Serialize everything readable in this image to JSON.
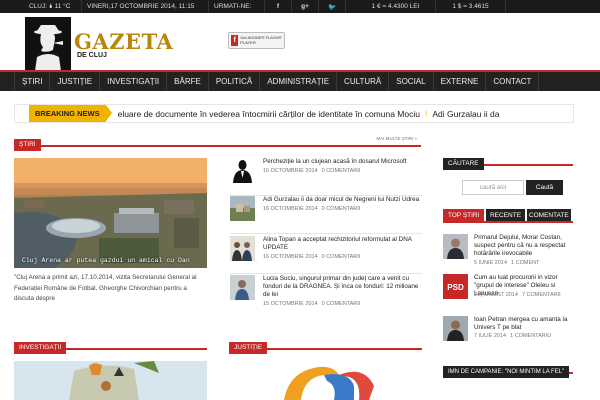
{
  "topbar": {
    "weather": "CLUJ: 🌢 11 °C",
    "date": "VINERI,17 OCTOMBRIE 2014, 11:15",
    "follow": "URMATI-NE:",
    "social": [
      "f",
      "g+",
      "🐦"
    ],
    "euro_rate": "1 € = 4.4300 LEI",
    "usd_rate": "1 $ = 3.4615"
  },
  "logo": {
    "title": "GAZETA",
    "subtitle": "DE CLUJ"
  },
  "flash_badge": {
    "icon": "f",
    "text": "Get ADOBE® FLASH® PLAYER"
  },
  "nav": {
    "items": [
      "ȘTIRI",
      "JUSTIȚIE",
      "INVESTIGAȚII",
      "BÂRFE",
      "POLITICĂ",
      "ADMINISTRAȚIE",
      "CULTURĂ",
      "SOCIAL",
      "EXTERNE",
      "CONTACT"
    ]
  },
  "breaking": {
    "label": "BREAKING NEWS",
    "ticker": [
      "eluare de documente în vederea întocmirii cărților de identitate în comuna Mociu",
      "Adi Gurzalau ii da"
    ]
  },
  "stiri_section": {
    "label": "ȘTIRI",
    "more": "MAI MULTE ȘTIRI »"
  },
  "featured": {
    "caption": "Cluj Arena ar putea gazdui un amical cu Dan",
    "excerpt": "\"Cluj Arena a primit azi, 17.10.2014, vizita Secretarului General al Federației Române de Fotbal, Gheorghe Chivorchian pentru a discuta despre"
  },
  "news_list": [
    {
      "title": "Percheziție la un clujean acasă în dosarul Microsoft",
      "date": "16 OCTOMBRIE 2014",
      "comments": "0 COMENTARII"
    },
    {
      "title": "Adi Gurzalau ii da doar micul de Negreni lui Nutzi Udrea",
      "date": "16 OCTOMBRIE 2014",
      "comments": "0 COMENTARII"
    },
    {
      "title": "Alina Topan a acceptat rechizitoriul reformulat al DNA UPDATE",
      "date": "16 OCTOMBRIE 2014",
      "comments": "0 COMENTARII"
    },
    {
      "title": "Lucia Suciu, singurul primar din județ care a venit cu fonduri de la DRAGNEA. Și înca ce fonduri: 12 milioane de lei",
      "date": "15 OCTOMBRIE 2014",
      "comments": "0 COMENTARII"
    }
  ],
  "investigatii_section": {
    "label": "INVESTIGAȚII"
  },
  "justitie_section": {
    "label": "JUSTIȚIE"
  },
  "sidebar": {
    "search_head": "CĂUTARE",
    "search_placeholder": "caută aici",
    "search_button": "Caută",
    "tabs": [
      "TOP ȘTIRI",
      "RECENTE",
      "COMENTATE"
    ],
    "items": [
      {
        "title": "Primarul Dejului, Morar Costan, suspect pentru că nu a respectat hotărârile irevocabile",
        "date": "",
        "comments": ""
      },
      {
        "title": "Cum au luat procurorii in vizor \"grupul de interese\" Oleleu si Lapusan",
        "date": "21 AUGUST 2014",
        "comments": "7 COMENTARII"
      },
      {
        "title": "Ioan Petran mergea cu amanta la Univers T pe blat",
        "date": "7 IULIE 2014",
        "comments": "1 COMENTARIU"
      }
    ],
    "pre_item_meta": {
      "date": "5 IUNIE 2014",
      "comments": "1 COMENT"
    },
    "campaign_head": "IMN DE CAMPANIE: \"NOI MINTIM LA FEL\""
  },
  "colors": {
    "accent": "#c62828",
    "breaking": "#f0b400",
    "dark": "#222222",
    "logo_gold": "#b8860b"
  }
}
